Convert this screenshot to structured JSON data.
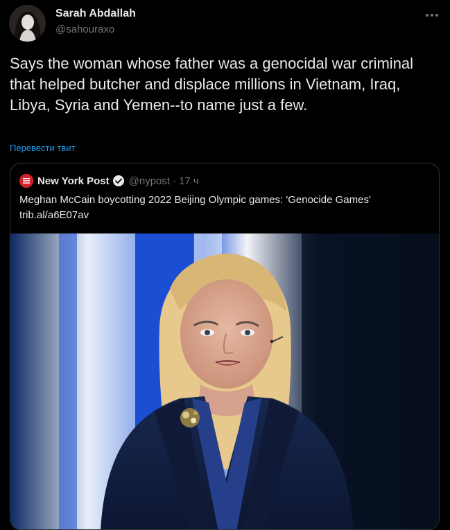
{
  "tweet": {
    "author_name": "Sarah Abdallah",
    "author_handle": "@sahouraxo",
    "text": "Says the woman whose father was a genocidal war criminal that helped butcher and displace millions in Vietnam, Iraq, Libya, Syria and Yemen--to name just a few.",
    "translate_label": "Перевести твит",
    "more_icon": "more-horizontal-icon",
    "avatar_icon": "user-avatar"
  },
  "quote": {
    "source_logo": "NEW YORK POST",
    "source_name": "New York Post",
    "verified_icon": "verified-badge-icon",
    "source_handle": "@nypost",
    "separator": "·",
    "time": "17 ч",
    "text": "Meghan McCain boycotting 2022 Beijing Olympic games: 'Genocide Games'",
    "link": "trib.al/a6E07av"
  },
  "colors": {
    "background": "#000000",
    "text_primary": "#e7e9ea",
    "text_secondary": "#71767b",
    "accent": "#1d9bf0",
    "border": "#2f3336",
    "nyp_red": "#d3212c"
  }
}
